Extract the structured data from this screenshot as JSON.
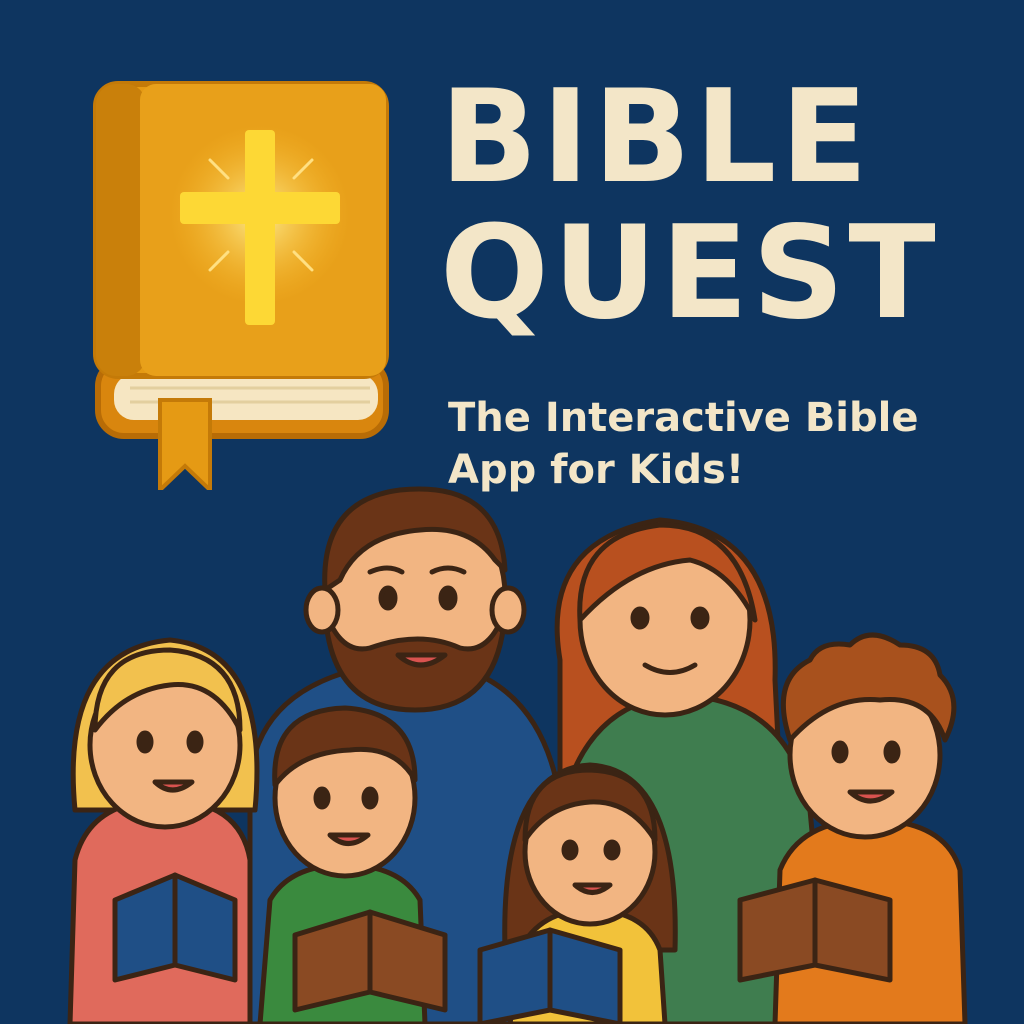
{
  "title": {
    "line1": "BIBLE",
    "line2": "QUEST"
  },
  "subtitle": {
    "line1": "The Interactive Bible",
    "line2": "App for Kids!"
  },
  "colors": {
    "background": "#0e3560",
    "title_text": "#f3e6c8",
    "book_cover": "#e59a14",
    "cross": "#fdd835"
  },
  "icons": [
    "bible-book-icon",
    "cross-icon",
    "bookmark-icon"
  ],
  "illustration": {
    "people": [
      "father",
      "mother",
      "blonde-girl",
      "boy-green-shirt",
      "girl-yellow-shirt",
      "curly-boy-orange-shirt"
    ]
  }
}
